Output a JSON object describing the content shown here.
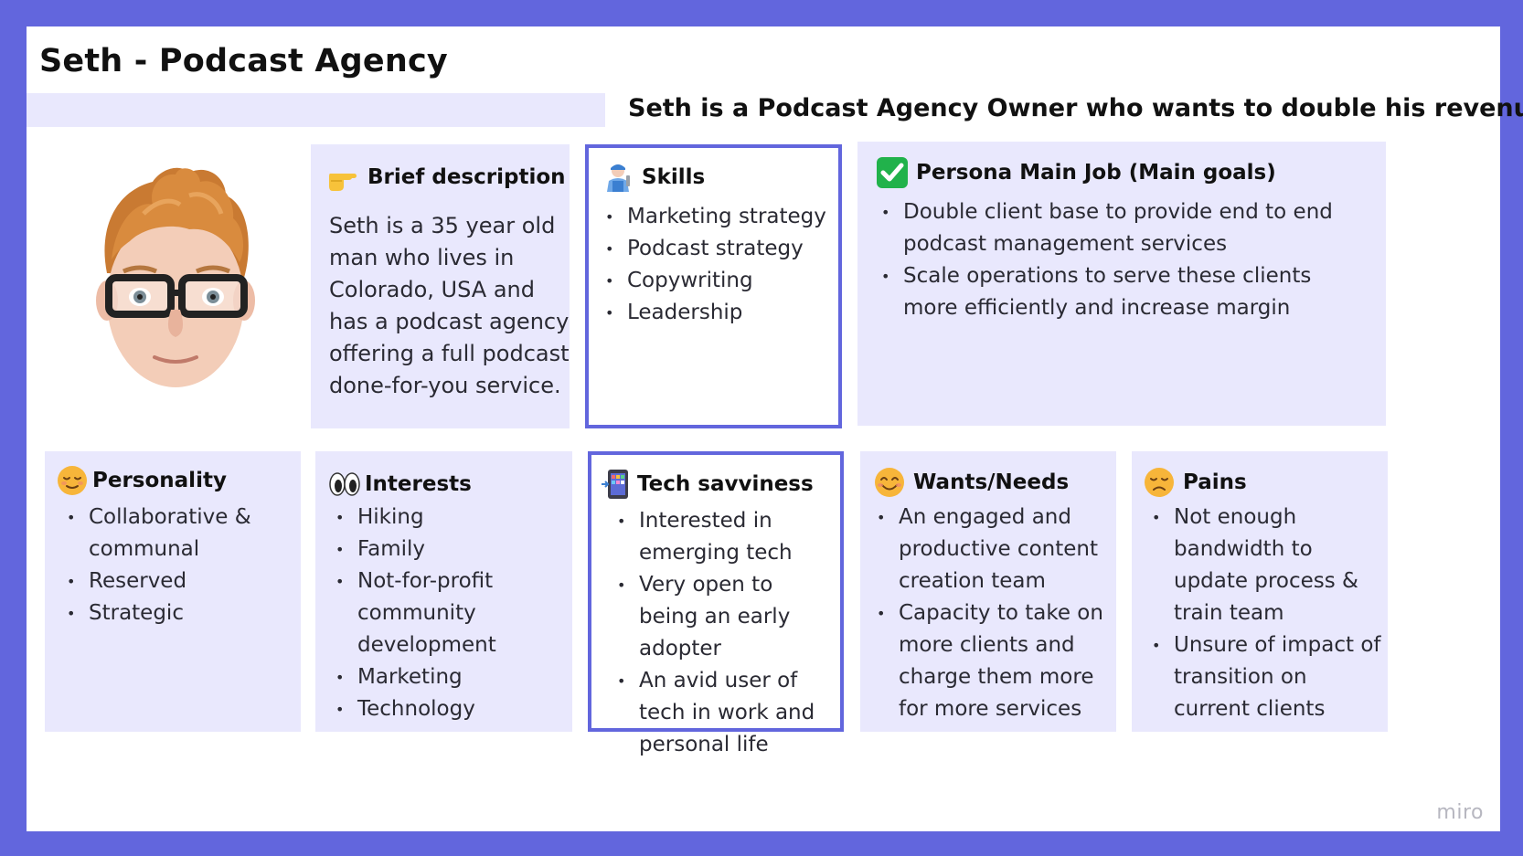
{
  "title": "Seth - Podcast Agency",
  "summary": "Seth is a Podcast Agency Owner who wants to double his revenue",
  "brief": {
    "heading": "Brief description",
    "icon": "pointing-hand-icon",
    "text": "Seth is a 35 year old man who lives in Colorado, USA and has a podcast agency offering a full podcast done-for-you service."
  },
  "skills": {
    "heading": "Skills",
    "icon": "mechanic-icon",
    "items": [
      "Marketing strategy",
      "Podcast strategy",
      "Copywriting",
      "Leadership"
    ]
  },
  "main_job": {
    "heading": "Persona Main Job (Main goals)",
    "icon": "check-mark-icon",
    "items": [
      "Double client base to provide end to end podcast management services",
      "Scale operations to serve these clients more efficiently and increase margin"
    ]
  },
  "personality": {
    "heading": "Personality",
    "icon": "relieved-face-icon",
    "items": [
      "Collaborative & communal",
      "Reserved",
      "Strategic"
    ]
  },
  "interests": {
    "heading": "Interests",
    "icon": "eyes-icon",
    "items": [
      "Hiking",
      "Family",
      "Not-for-profit community development",
      "Marketing",
      "Technology"
    ]
  },
  "tech": {
    "heading": "Tech savviness",
    "icon": "mobile-phone-icon",
    "items": [
      "Interested in emerging tech",
      "Very open to being an early adopter",
      "An avid user of tech in work and personal life"
    ]
  },
  "wants": {
    "heading": "Wants/Needs",
    "icon": "smiling-face-icon",
    "items": [
      "An engaged and productive content creation team",
      "Capacity to take on more clients and charge them more for more services"
    ]
  },
  "pains": {
    "heading": "Pains",
    "icon": "disappointed-face-icon",
    "items": [
      "Not enough bandwidth to update process & train team",
      "Unsure of impact of transition on current clients"
    ]
  },
  "watermark": "miro",
  "colors": {
    "frame": "#6266dd",
    "card": "#e9e8fd",
    "text": "#1f1f2a"
  }
}
